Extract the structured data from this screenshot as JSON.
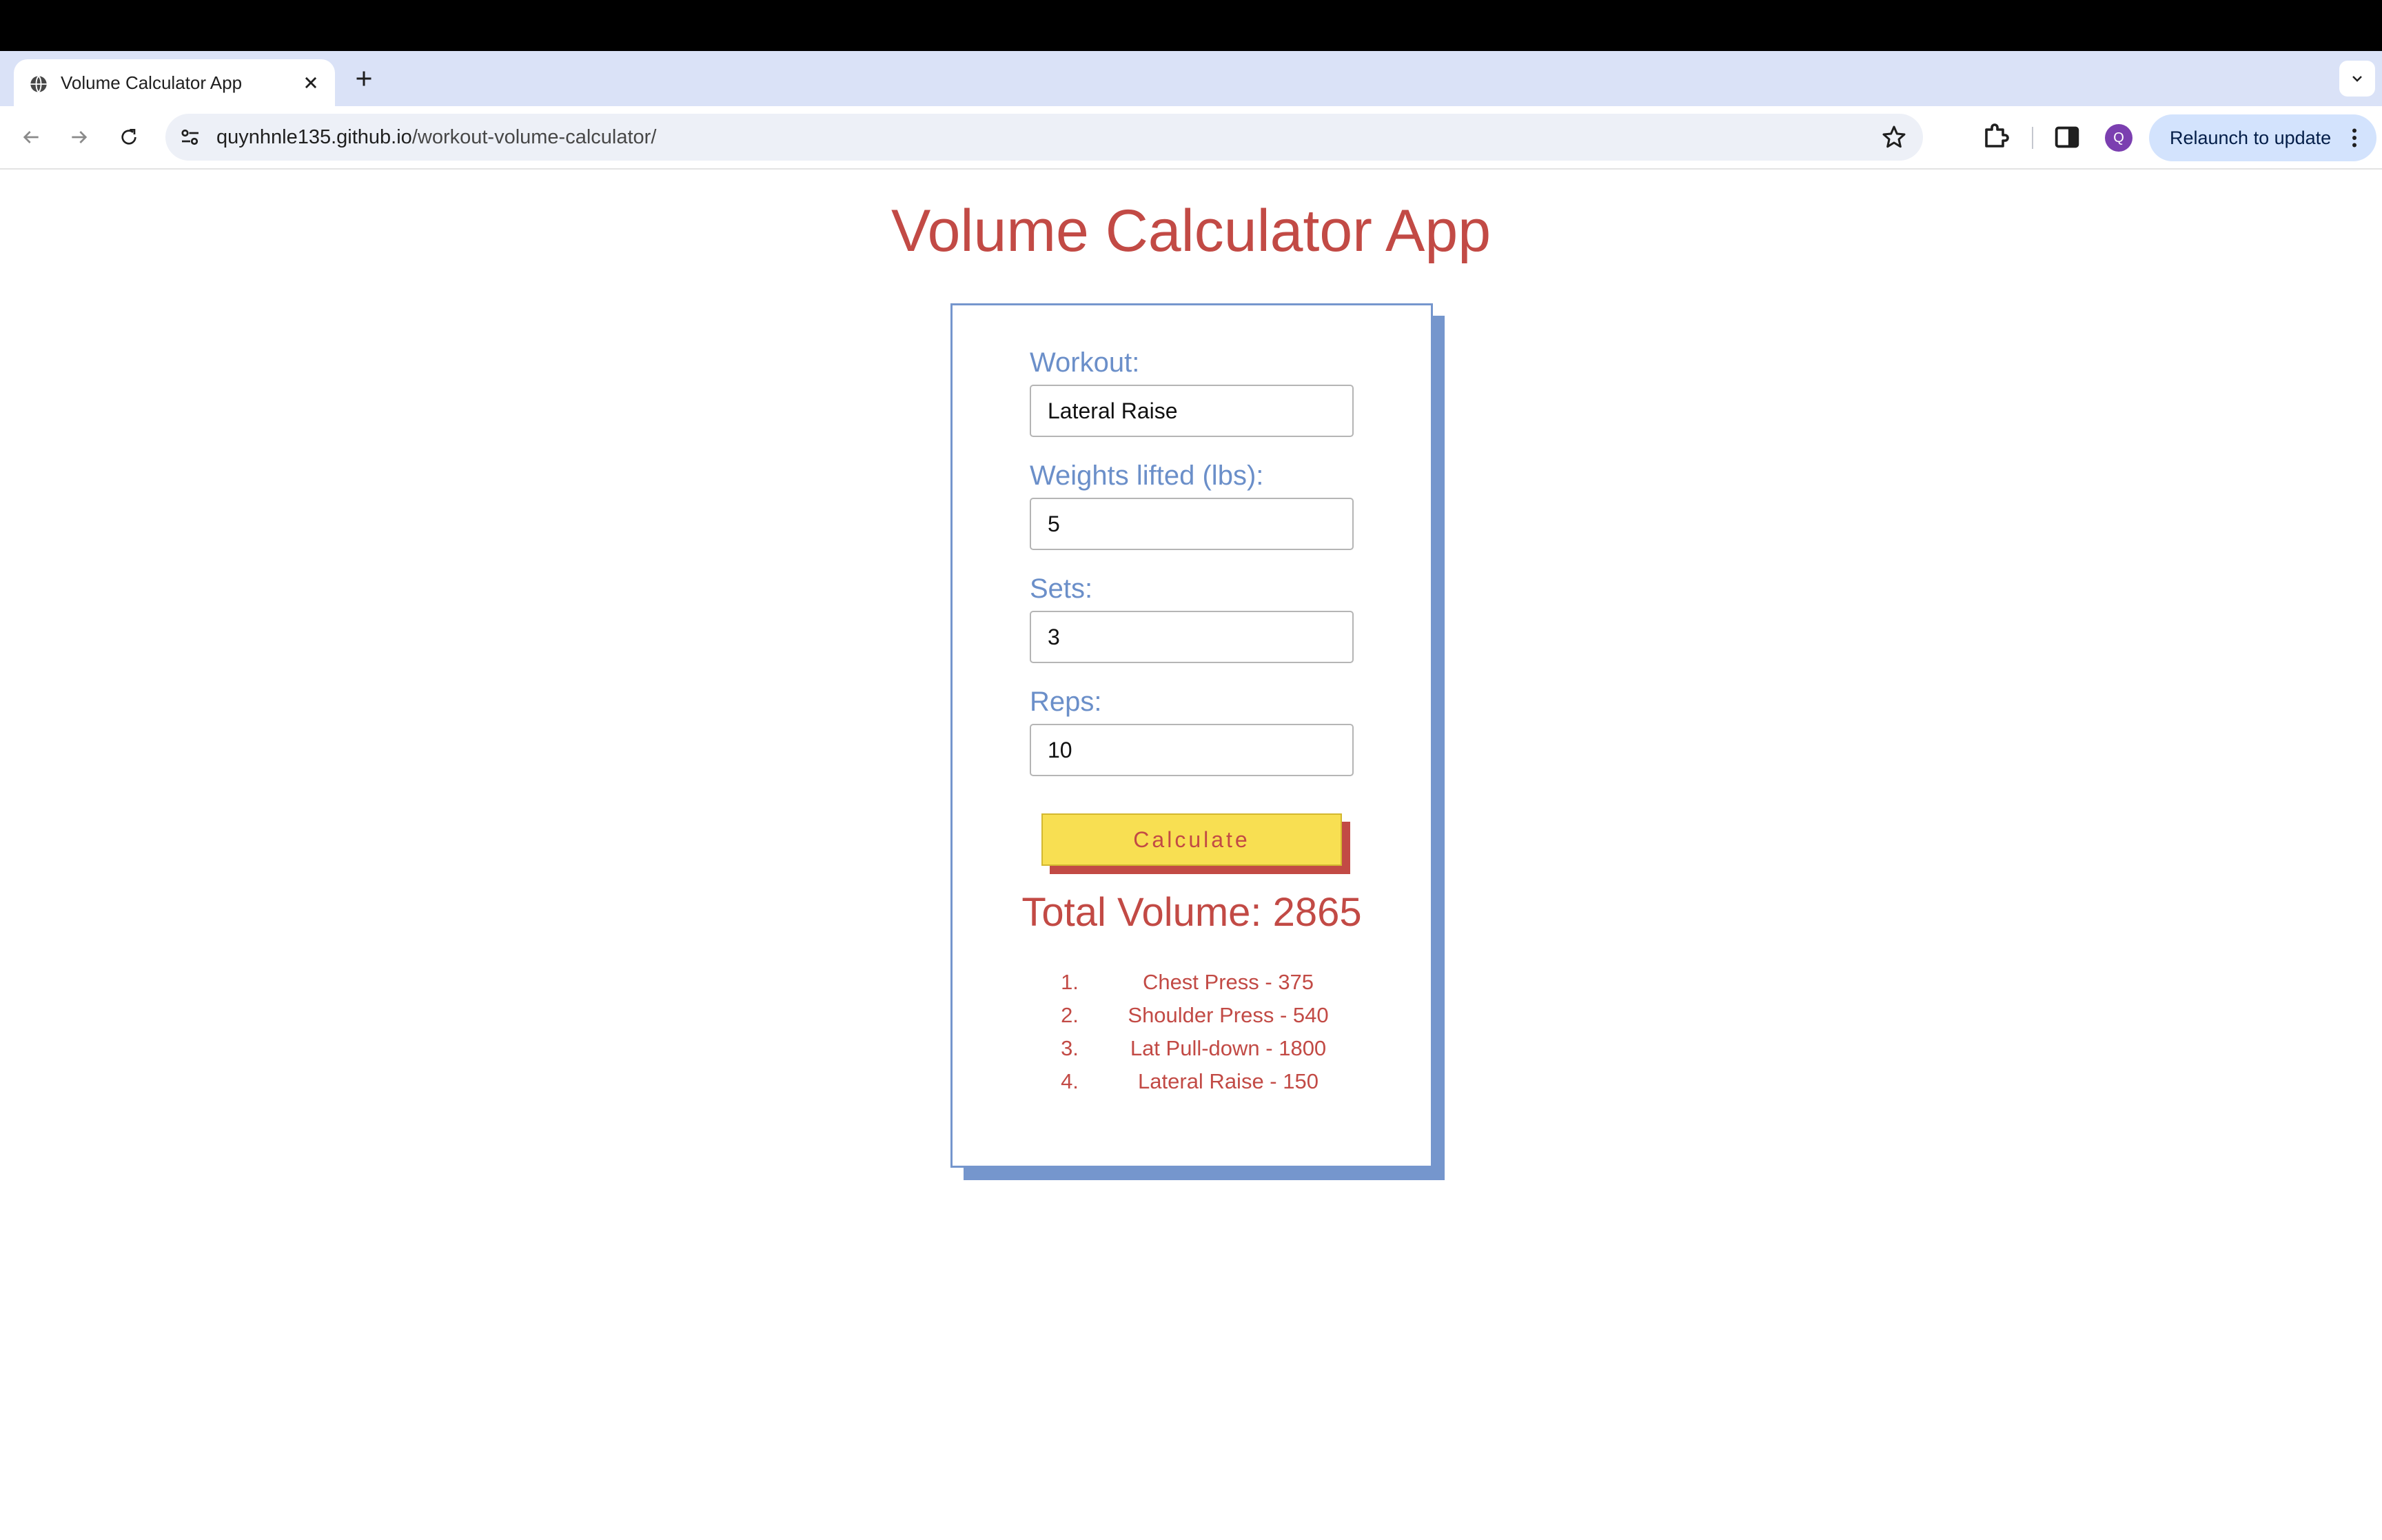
{
  "browser": {
    "tab": {
      "title": "Volume Calculator App",
      "favicon": "globe-icon"
    },
    "url": {
      "host": "quynhnle135.github.io",
      "path": "/workout-volume-calculator/"
    },
    "profile_initial": "Q",
    "relaunch_label": "Relaunch to update"
  },
  "page": {
    "title": "Volume Calculator App",
    "form": {
      "workout": {
        "label": "Workout:",
        "value": "Lateral Raise"
      },
      "weight": {
        "label": "Weights lifted (lbs):",
        "value": "5"
      },
      "sets": {
        "label": "Sets:",
        "value": "3"
      },
      "reps": {
        "label": "Reps:",
        "value": "10"
      }
    },
    "calculate_label": "Calculate",
    "total_text": "Total Volume: 2865",
    "results": [
      {
        "num": "1.",
        "text": "Chest Press - 375"
      },
      {
        "num": "2.",
        "text": "Shoulder Press - 540"
      },
      {
        "num": "3.",
        "text": "Lat Pull-down - 1800"
      },
      {
        "num": "4.",
        "text": "Lateral Raise - 150"
      }
    ]
  },
  "colors": {
    "title_red": "#c24a45",
    "label_blue": "#6b8fc9",
    "card_border": "#7596cd",
    "button_yellow": "#f8df52"
  }
}
